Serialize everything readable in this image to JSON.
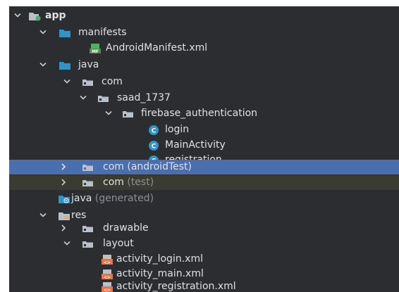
{
  "tree": {
    "app": {
      "label": "app"
    },
    "manifests": {
      "label": "manifests"
    },
    "manifest_file": {
      "label": "AndroidManifest.xml",
      "badge": "MF"
    },
    "java": {
      "label": "java"
    },
    "com": {
      "label": "com"
    },
    "saad": {
      "label": "saad_1737"
    },
    "firebase": {
      "label": "firebase_authentication"
    },
    "login": {
      "label": "login",
      "badge": "C"
    },
    "main_activity": {
      "label": "MainActivity",
      "badge": "C"
    },
    "registration": {
      "label": "registration",
      "badge": "C"
    },
    "com_android_test": {
      "label": "com",
      "suffix": "(androidTest)"
    },
    "com_test": {
      "label": "com",
      "suffix": "(test)"
    },
    "java_generated": {
      "label": "java",
      "suffix": "(generated)"
    },
    "res": {
      "label": "res"
    },
    "drawable": {
      "label": "drawable"
    },
    "layout": {
      "label": "layout"
    },
    "activity_login": {
      "label": "activity_login.xml",
      "badge": "<>"
    },
    "activity_main": {
      "label": "activity_main.xml",
      "badge": "<>"
    },
    "activity_registration": {
      "label": "activity_registration.xml",
      "badge": "<>"
    }
  },
  "colors": {
    "panel_background": "#2b2d30",
    "selected_row": "#4b6eaf",
    "secondary_row": "#3a3c32",
    "text": "#dfe1e5",
    "muted_text": "#8c8f94",
    "folder_icon": "#b8c0cc",
    "source_folder_icon": "#3592c4",
    "class_icon": "#3592c4",
    "xml_icon": "#e8754a",
    "module_dot": "#4ab26a"
  }
}
